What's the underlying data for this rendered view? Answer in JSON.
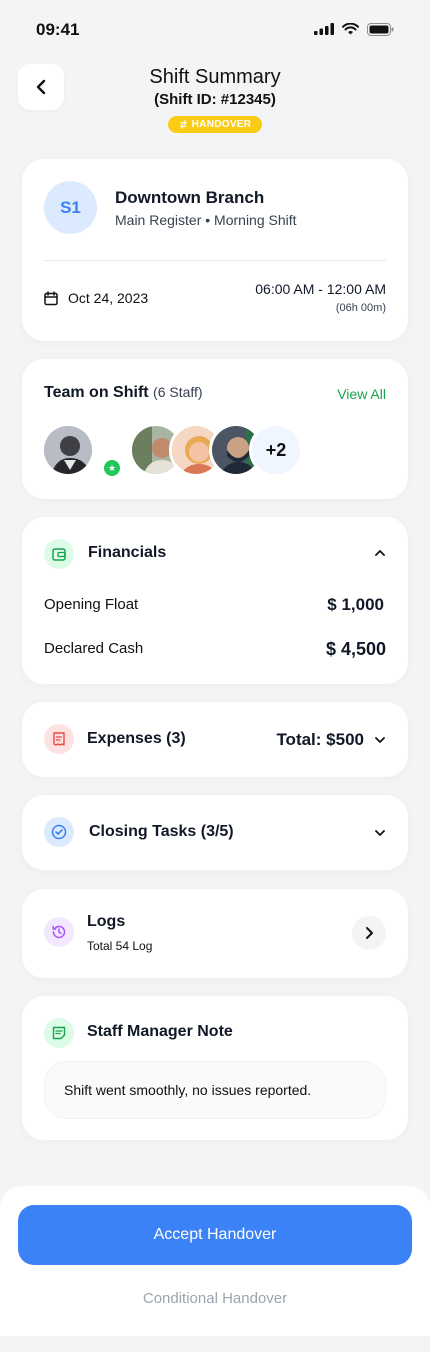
{
  "status_bar": {
    "time": "09:41"
  },
  "header": {
    "title": "Shift Summary",
    "subtitle": "(Shift ID: #12345)",
    "badge": "HANDOVER"
  },
  "branch": {
    "initials": "S1",
    "name": "Downtown Branch",
    "details": "Main Register • Morning Shift",
    "date": "Oct 24, 2023",
    "time_range": "06:00 AM - 12:00 AM",
    "duration": "(06h 00m)"
  },
  "team": {
    "title": "Team on Shift",
    "count": "(6 Staff)",
    "view_all": "View All",
    "more": "+2"
  },
  "financials": {
    "title": "Financials",
    "rows": [
      {
        "label": "Opening Float",
        "value": "$ 1,000"
      },
      {
        "label": "Declared Cash",
        "value": "$ 4,500"
      }
    ]
  },
  "expenses": {
    "title": "Expenses (3)",
    "total": "Total: $500"
  },
  "closing_tasks": {
    "title": "Closing Tasks (3/5)"
  },
  "logs": {
    "title": "Logs",
    "subtitle": "Total 54 Log"
  },
  "note": {
    "title": "Staff Manager Note",
    "text": "Shift went smoothly, no issues reported."
  },
  "actions": {
    "accept": "Accept Handover",
    "conditional": "Conditional Handover"
  },
  "colors": {
    "primary": "#3b82f6",
    "badge": "#facc15",
    "success": "#16a34a",
    "expense_red": "#ef4444",
    "logs_purple": "#a855f7"
  }
}
